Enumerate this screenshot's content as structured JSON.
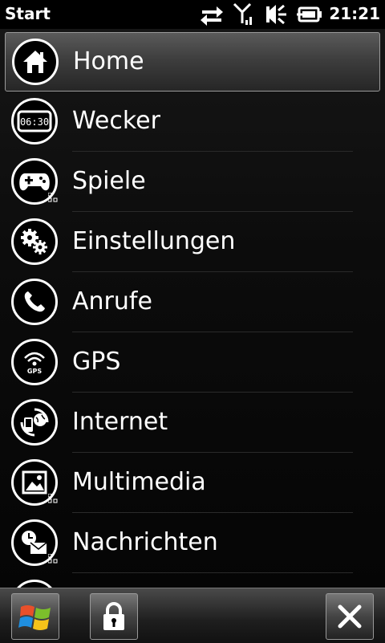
{
  "statusbar": {
    "title": "Start",
    "time": "21:21",
    "icons": [
      "data-sync-icon",
      "signal-icon",
      "volume-icon",
      "battery-charging-icon"
    ]
  },
  "menu": {
    "items": [
      {
        "label": "Home",
        "icon": "home-icon",
        "selected": true
      },
      {
        "label": "Wecker",
        "icon": "alarm-clock-icon",
        "clock_text": "06:30"
      },
      {
        "label": "Spiele",
        "icon": "gamepad-icon",
        "has_submenu": true
      },
      {
        "label": "Einstellungen",
        "icon": "gears-icon"
      },
      {
        "label": "Anrufe",
        "icon": "phone-icon"
      },
      {
        "label": "GPS",
        "icon": "gps-icon",
        "icon_text": "GPS"
      },
      {
        "label": "Internet",
        "icon": "internet-icon"
      },
      {
        "label": "Multimedia",
        "icon": "picture-icon",
        "has_submenu": true
      },
      {
        "label": "Nachrichten",
        "icon": "messages-icon",
        "has_submenu": true
      }
    ]
  },
  "bottombar": {
    "buttons": [
      "windows-start-icon",
      "lock-icon",
      "close-icon"
    ]
  },
  "colors": {
    "background": "#000000",
    "text": "#ffffff",
    "selected_bg": "#3e3e3e",
    "divider": "#2a2a2a"
  }
}
